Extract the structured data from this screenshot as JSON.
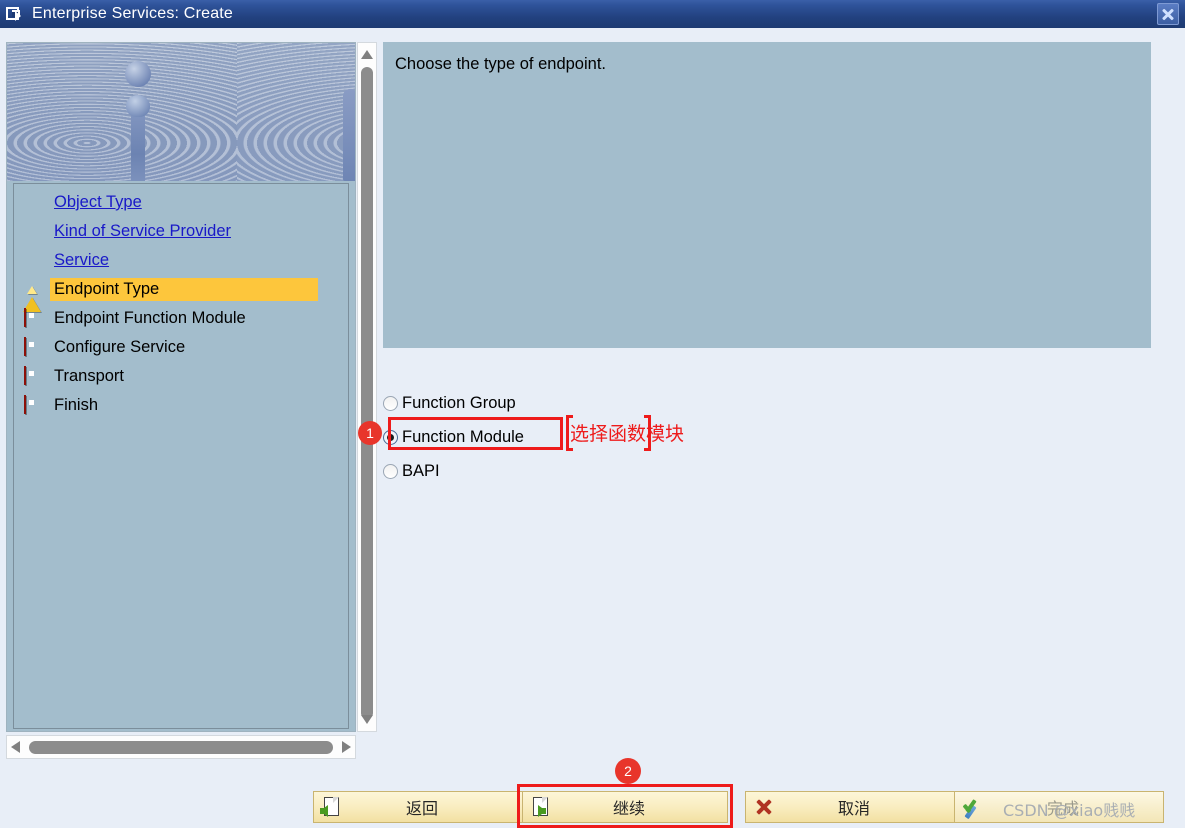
{
  "window": {
    "title": "Enterprise Services: Create",
    "title_icon": "window-object-icon",
    "close_icon": "close-icon",
    "accent_color": "#22417f",
    "panel_color": "#a3bdcc",
    "highlight_color": "#fdc63c",
    "annotation_color": "#ee1b1b"
  },
  "roadmap": {
    "steps": [
      {
        "label": "Object Type",
        "state": "done",
        "icon": "green-ball-icon"
      },
      {
        "label": "Kind of Service Provider",
        "state": "done",
        "icon": "green-ball-icon"
      },
      {
        "label": "Service",
        "state": "done",
        "icon": "green-ball-icon"
      },
      {
        "label": "Endpoint Type",
        "state": "current",
        "icon": "yellow-triangle-icon"
      },
      {
        "label": "Endpoint Function Module",
        "state": "pending",
        "icon": "red-square-icon"
      },
      {
        "label": "Configure Service",
        "state": "pending",
        "icon": "red-square-icon"
      },
      {
        "label": "Transport",
        "state": "pending",
        "icon": "red-square-icon"
      },
      {
        "label": "Finish",
        "state": "pending",
        "icon": "red-square-icon"
      }
    ]
  },
  "content": {
    "instruction": "Choose the type of endpoint.",
    "options": [
      {
        "label": "Function Group",
        "selected": false
      },
      {
        "label": "Function Module",
        "selected": true
      },
      {
        "label": "BAPI",
        "selected": false
      }
    ]
  },
  "annotations": [
    {
      "badge": "1",
      "text": "选择函数模块"
    },
    {
      "badge": "2",
      "text": ""
    }
  ],
  "toolbar": {
    "buttons": [
      {
        "label": "返回",
        "icon": "page-back-icon",
        "enabled": true
      },
      {
        "label": "继续",
        "icon": "page-next-icon",
        "enabled": true
      },
      {
        "label": "取消",
        "icon": "red-x-icon",
        "enabled": true
      },
      {
        "label": "完成",
        "icon": "green-check-pen-icon",
        "enabled": false
      }
    ]
  },
  "watermark": "CSDN @xiao贱贱"
}
